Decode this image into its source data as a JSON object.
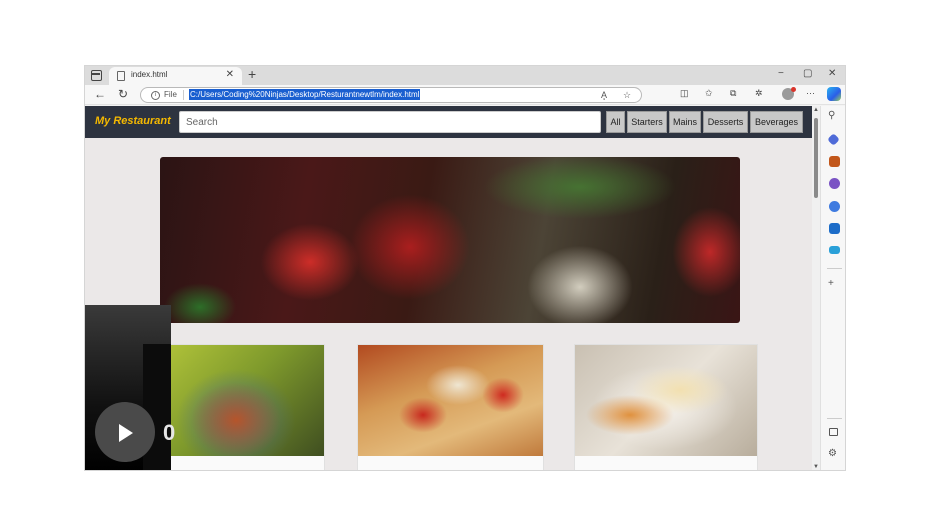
{
  "browser": {
    "tab_title": "index.html",
    "new_tab_symbol": "+",
    "url_scheme_label": "File",
    "url": "C:/Users/Coding%20Ninjas/Desktop/Resturantnewtlm/index.html",
    "controls": {
      "minimize": "−",
      "restore": "▢",
      "close": "✕",
      "tab_close": "✕"
    },
    "nav": {
      "back": "←",
      "refresh": "↻"
    },
    "toolbar": {
      "read_aloud": "A̧",
      "favorite": "☆",
      "split": "◫",
      "favorites": "✩",
      "collections": "⧉",
      "more": "···"
    }
  },
  "site": {
    "brand": "My Restaurant",
    "search_placeholder": "Search",
    "categories": [
      "All",
      "Starters",
      "Mains",
      "Desserts",
      "Beverages"
    ]
  },
  "video_overlay": {
    "digit": "0"
  },
  "sidebar": {
    "icons": [
      "search-icon",
      "tag-icon",
      "briefcase-icon",
      "people-icon",
      "office-icon",
      "outlook-icon",
      "send-icon",
      "add-icon",
      "panel-icon",
      "settings-icon"
    ],
    "add_symbol": "+",
    "settings_symbol": "⚙"
  },
  "colors": {
    "nav_bg": "#2d3340",
    "brand": "#f5b900",
    "url_highlight": "#1a5fd0",
    "page_bg": "#ebe8e8"
  }
}
